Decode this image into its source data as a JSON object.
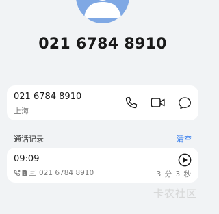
{
  "header": {
    "avatar_icon": "person-avatar-icon",
    "phone_number": "021 6784 8910"
  },
  "contact_card": {
    "number": "021 6784 8910",
    "location": "上海",
    "actions": [
      {
        "icon": "phone-call-icon"
      },
      {
        "icon": "video-call-icon"
      },
      {
        "icon": "message-icon"
      }
    ]
  },
  "call_history": {
    "title": "通话记录",
    "clear_label": "清空",
    "records": [
      {
        "time": "09:09",
        "number": "021 6784 8910",
        "duration": "3 分 3 秒",
        "icons": [
          "outgoing-call-icon",
          "sim-1-icon",
          "recording-icon"
        ],
        "action_icon": "play-icon"
      }
    ]
  },
  "watermark": "卡农社区",
  "colors": {
    "background": "#f1f3f5",
    "card": "#ffffff",
    "accent": "#2a76ee",
    "avatar": "#7fa8e4"
  }
}
